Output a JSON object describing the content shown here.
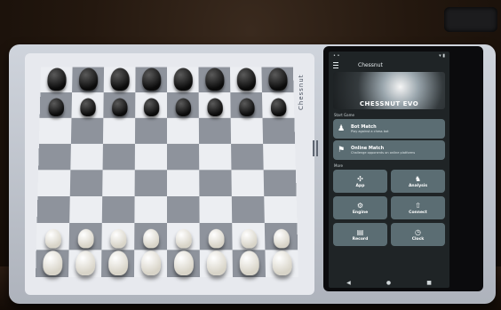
{
  "screen": {
    "app_title": "Chessnut",
    "banner_title": "CHESSNUT EVO",
    "section_game": "Start Game",
    "cards": [
      {
        "title": "Bot Match",
        "subtitle": "Play against a chess bot",
        "icon": "robot-icon"
      },
      {
        "title": "Online Match",
        "subtitle": "Challenge opponents on online platforms",
        "icon": "globe-icon"
      }
    ],
    "section_more": "More",
    "tiles": [
      {
        "label": "App",
        "icon": "apps-icon"
      },
      {
        "label": "Analysis",
        "icon": "analysis-icon"
      },
      {
        "label": "Engine",
        "icon": "engine-icon"
      },
      {
        "label": "Connect",
        "icon": "connect-icon"
      },
      {
        "label": "Record",
        "icon": "record-icon"
      },
      {
        "label": "Clock",
        "icon": "clock-icon"
      }
    ]
  },
  "board_logo": "Chessnut",
  "colors": {
    "tile": "#5b6d73",
    "screen_bg": "#1f2426",
    "dark_square": "#8e939c",
    "light_square": "#eceef2"
  }
}
